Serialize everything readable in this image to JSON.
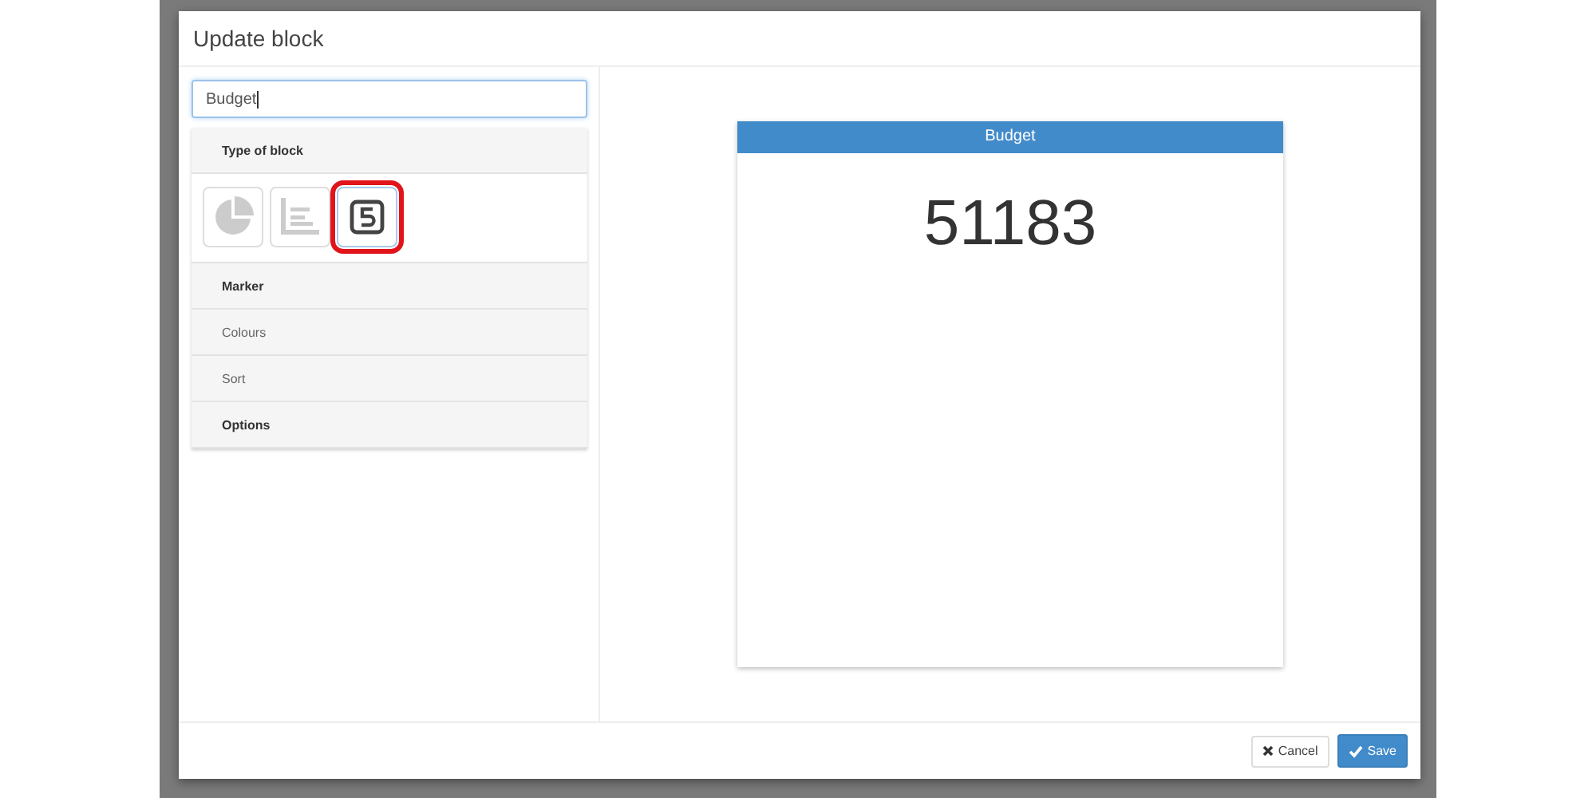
{
  "dialog": {
    "title": "Update block"
  },
  "name_field": {
    "value": "Budget"
  },
  "sections": [
    {
      "label": "Type of block",
      "kind": "type_picker",
      "disabled": false
    },
    {
      "label": "Marker",
      "kind": "plain",
      "disabled": false
    },
    {
      "label": "Colours",
      "kind": "plain",
      "disabled": true
    },
    {
      "label": "Sort",
      "kind": "plain",
      "disabled": true
    },
    {
      "label": "Options",
      "kind": "plain",
      "disabled": false
    }
  ],
  "block_types": [
    {
      "kind": "pie",
      "selected": false
    },
    {
      "kind": "list",
      "selected": false
    },
    {
      "kind": "number",
      "selected": true
    }
  ],
  "preview": {
    "title": "Budget",
    "value": "51183"
  },
  "buttons": [
    {
      "kind": "cancel",
      "label": "Cancel"
    },
    {
      "kind": "save",
      "label": "Save"
    }
  ]
}
